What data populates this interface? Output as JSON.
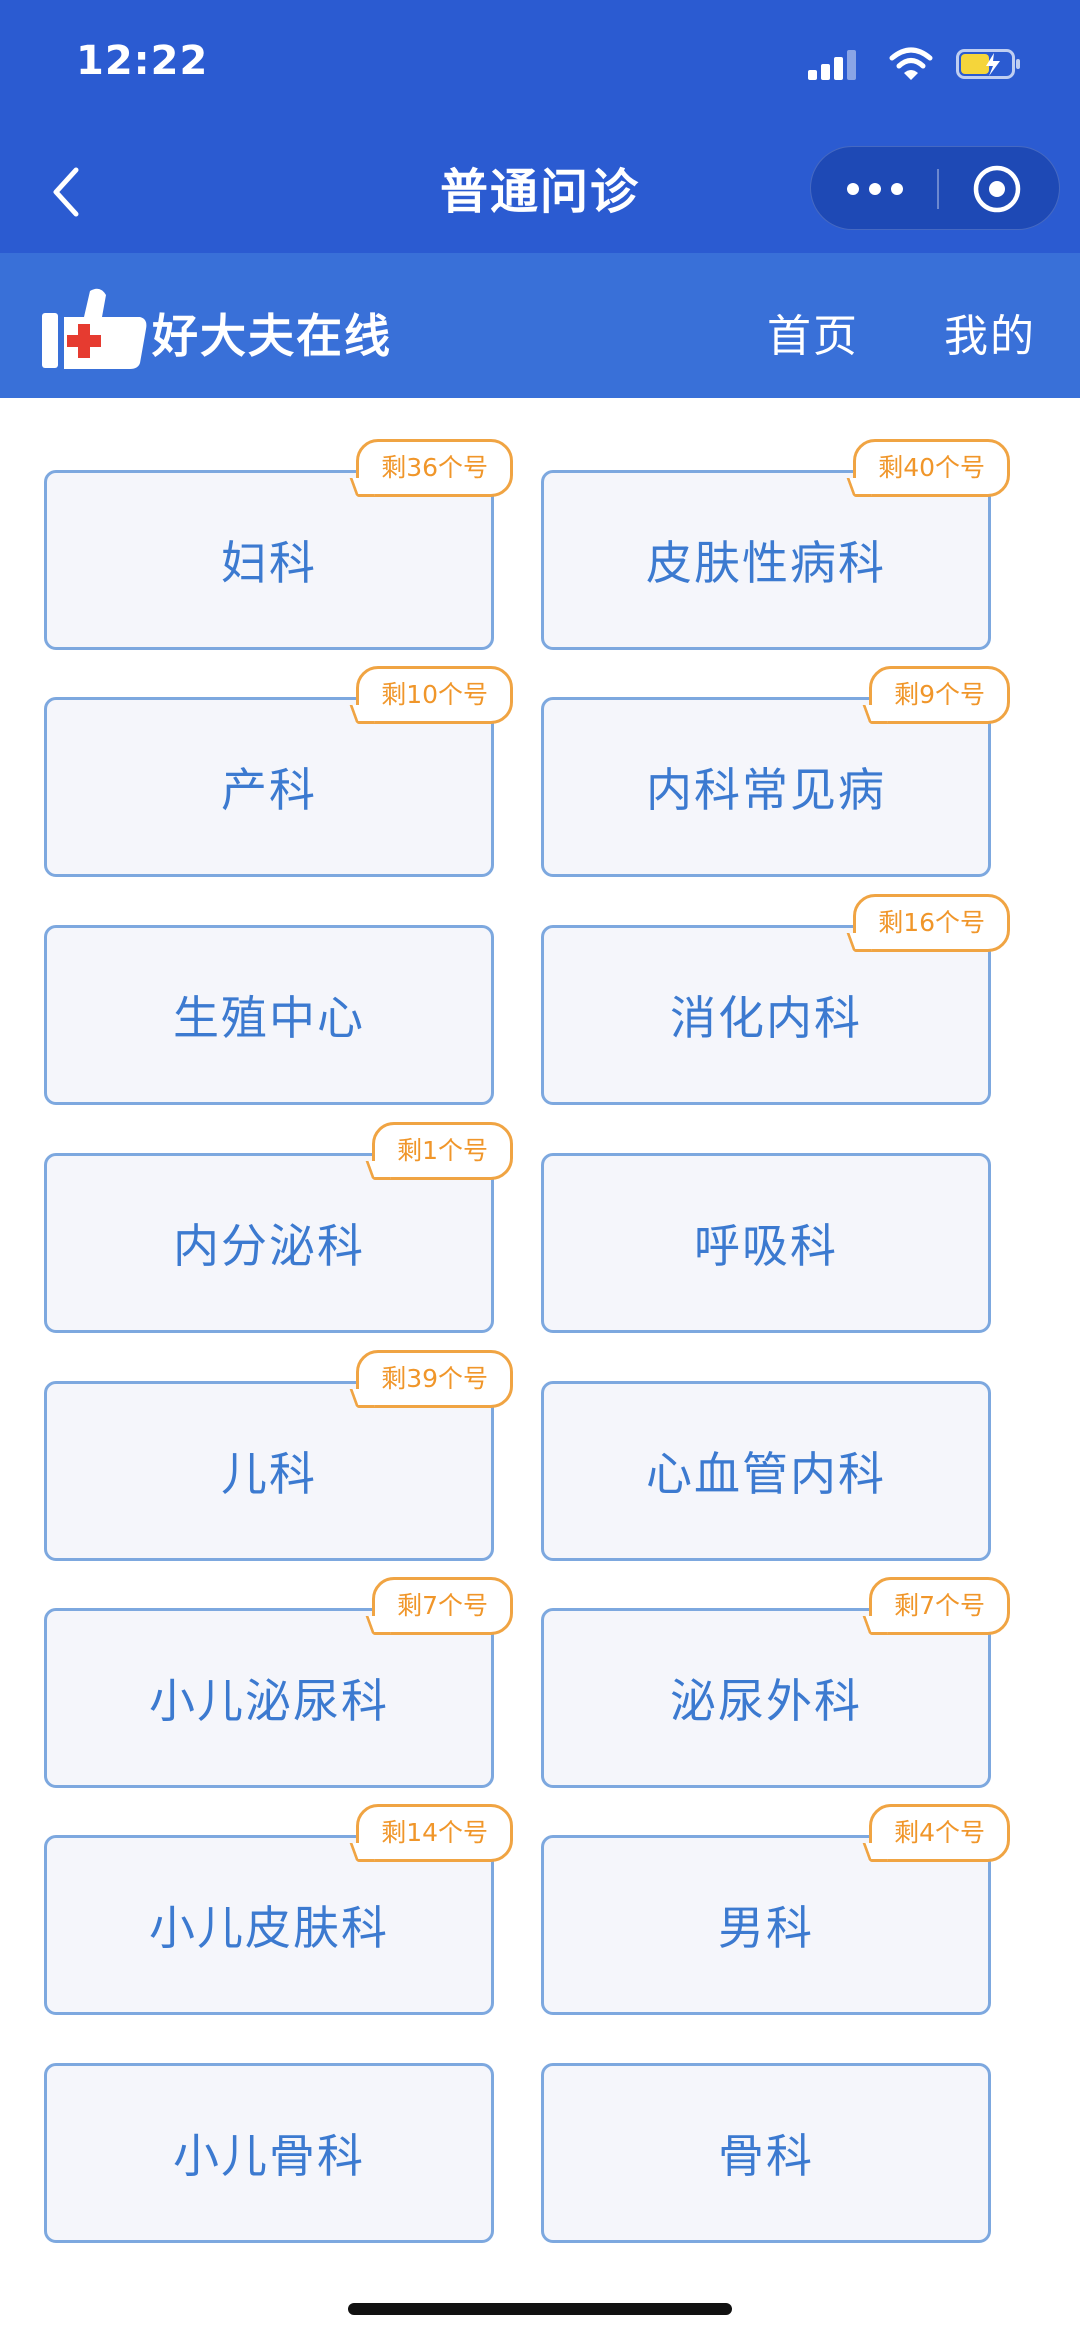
{
  "status_bar": {
    "time": "12:22"
  },
  "nav": {
    "title": "普通问诊"
  },
  "brand": {
    "name": "好大夫在线",
    "links": {
      "home": "首页",
      "mine": "我的"
    }
  },
  "departments": [
    {
      "name": "妇科",
      "badge": "剩36个号"
    },
    {
      "name": "皮肤性病科",
      "badge": "剩40个号"
    },
    {
      "name": "产科",
      "badge": "剩10个号"
    },
    {
      "name": "内科常见病",
      "badge": "剩9个号"
    },
    {
      "name": "生殖中心",
      "badge": ""
    },
    {
      "name": "消化内科",
      "badge": "剩16个号"
    },
    {
      "name": "内分泌科",
      "badge": "剩1个号"
    },
    {
      "name": "呼吸科",
      "badge": ""
    },
    {
      "name": "儿科",
      "badge": "剩39个号"
    },
    {
      "name": "心血管内科",
      "badge": ""
    },
    {
      "name": "小儿泌尿科",
      "badge": "剩7个号"
    },
    {
      "name": "泌尿外科",
      "badge": "剩7个号"
    },
    {
      "name": "小儿皮肤科",
      "badge": "剩14个号"
    },
    {
      "name": "男科",
      "badge": "剩4个号"
    },
    {
      "name": "小儿骨科",
      "badge": ""
    },
    {
      "name": "骨科",
      "badge": ""
    }
  ],
  "colors": {
    "nav_bg": "#2b5bd1",
    "brand_bg": "#3970d8",
    "card_border": "#7da8df",
    "card_text": "#3c7ad0",
    "badge": "#f0a443"
  }
}
